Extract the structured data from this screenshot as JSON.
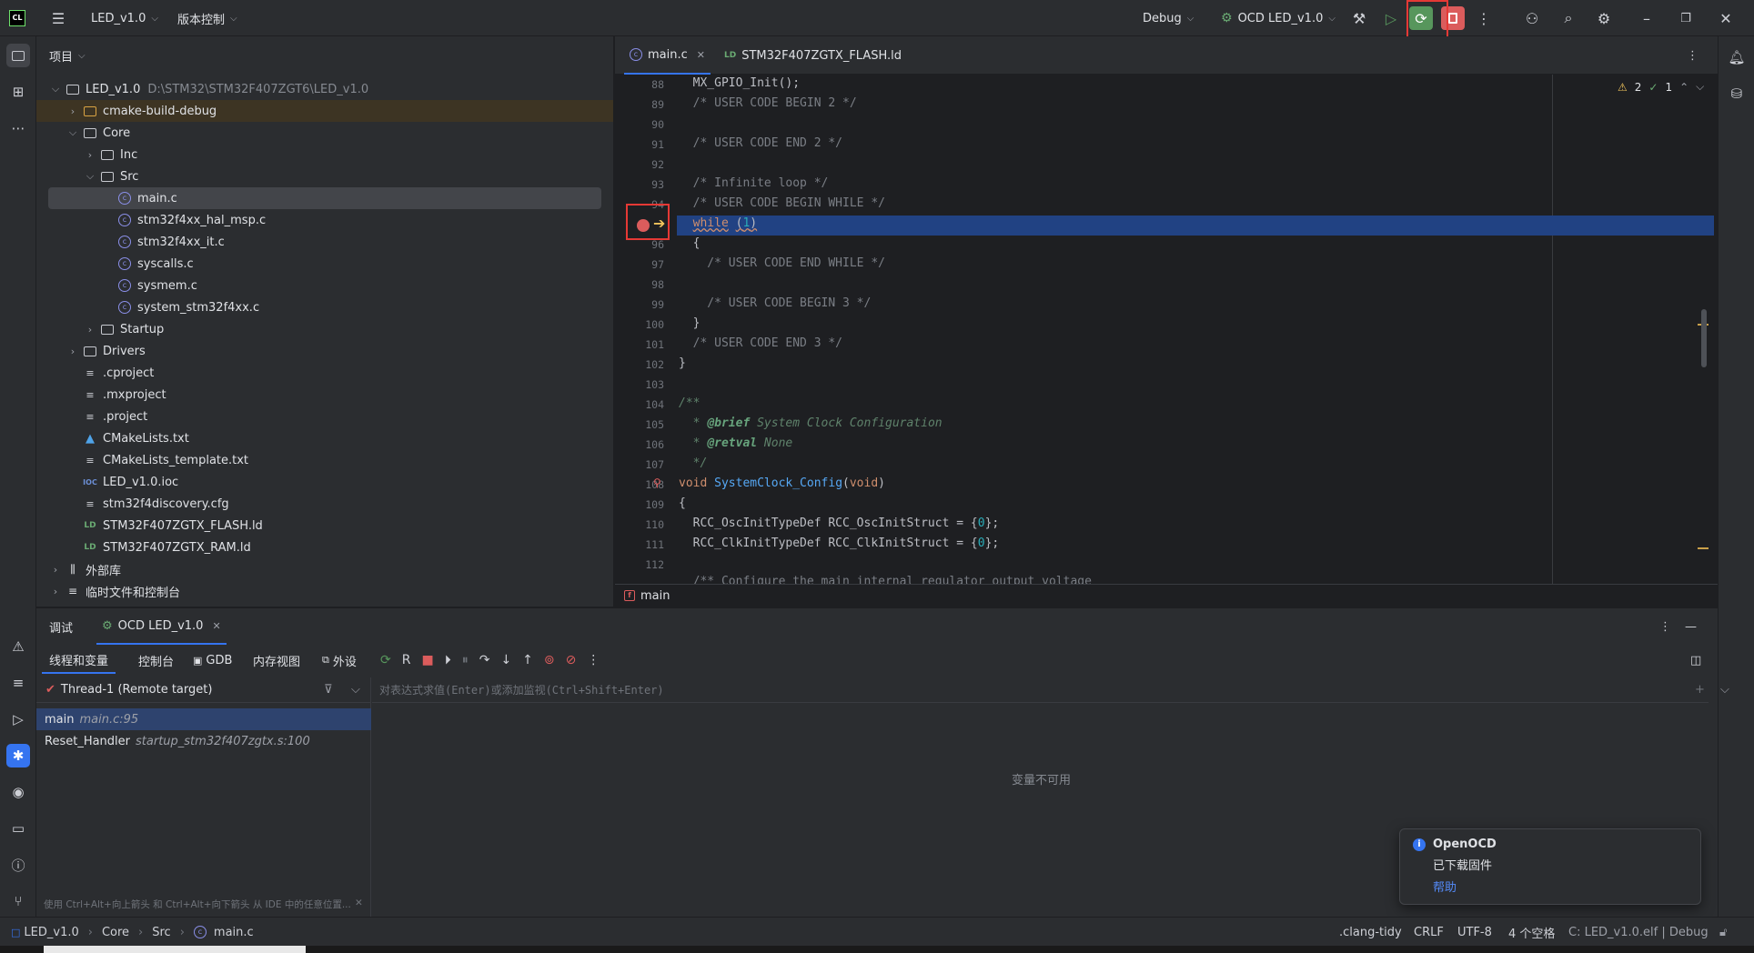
{
  "titlebar": {
    "app_logo": "CL",
    "project_name": "LED_v1.0",
    "vcs_label": "版本控制",
    "build_config": "Debug",
    "run_config": "OCD LED_v1.0"
  },
  "project_panel": {
    "title": "项目",
    "tree": [
      {
        "label": "LED_v1.0",
        "path": "D:\\STM32\\STM32F407ZGT6\\LED_v1.0"
      },
      {
        "label": "cmake-build-debug"
      },
      {
        "label": "Core"
      },
      {
        "label": "Inc"
      },
      {
        "label": "Src"
      },
      {
        "label": "main.c"
      },
      {
        "label": "stm32f4xx_hal_msp.c"
      },
      {
        "label": "stm32f4xx_it.c"
      },
      {
        "label": "syscalls.c"
      },
      {
        "label": "sysmem.c"
      },
      {
        "label": "system_stm32f4xx.c"
      },
      {
        "label": "Startup"
      },
      {
        "label": "Drivers"
      },
      {
        "label": ".cproject"
      },
      {
        "label": ".mxproject"
      },
      {
        "label": ".project"
      },
      {
        "label": "CMakeLists.txt"
      },
      {
        "label": "CMakeLists_template.txt"
      },
      {
        "label": "LED_v1.0.ioc"
      },
      {
        "label": "stm32f4discovery.cfg"
      },
      {
        "label": "STM32F407ZGTX_FLASH.ld"
      },
      {
        "label": "STM32F407ZGTX_RAM.ld"
      },
      {
        "label": "外部库"
      },
      {
        "label": "临时文件和控制台"
      }
    ]
  },
  "editor": {
    "tabs": [
      {
        "label": "main.c"
      },
      {
        "label": "STM32F407ZGTX_FLASH.ld"
      }
    ],
    "inspections": {
      "warnings": "2",
      "ok": "1"
    },
    "line_numbers": [
      "88",
      "89",
      "90",
      "91",
      "92",
      "93",
      "94",
      "95",
      "96",
      "97",
      "98",
      "99",
      "100",
      "101",
      "102",
      "103",
      "104",
      "105",
      "106",
      "107",
      "108",
      "109",
      "110",
      "111",
      "112"
    ],
    "breadcrumb": "main"
  },
  "debug_panel": {
    "tab_debug": "调试",
    "tab_session": "OCD LED_v1.0",
    "subtabs": [
      "线程和变量",
      "控制台",
      "GDB",
      "内存视图",
      "外设"
    ],
    "thread": "Thread-1 (Remote target)",
    "frames": [
      {
        "name": "main",
        "loc": "main.c:95"
      },
      {
        "name": "Reset_Handler",
        "loc": "startup_stm32f407zgtx.s:100"
      }
    ],
    "eval_placeholder": "对表达式求值(Enter)或添加监视(Ctrl+Shift+Enter)",
    "vars_unavailable": "变量不可用",
    "hint": "使用 Ctrl+Alt+向上箭头 和 Ctrl+Alt+向下箭头 从 IDE 中的任意位置..."
  },
  "notification": {
    "title": "OpenOCD",
    "message": "已下载固件",
    "link": "帮助"
  },
  "statusbar": {
    "crumbs": [
      "LED_v1.0",
      "Core",
      "Src",
      "main.c"
    ],
    "lint": ".clang-tidy",
    "line_sep": "CRLF",
    "encoding": "UTF-8",
    "indent": "4 个空格",
    "context": "C: LED_v1.0.elf | Debug"
  },
  "colors": {
    "accent": "#3574f0",
    "run_green": "#57965c",
    "stop_red": "#db5c5c",
    "annotation_red": "#e53935"
  }
}
